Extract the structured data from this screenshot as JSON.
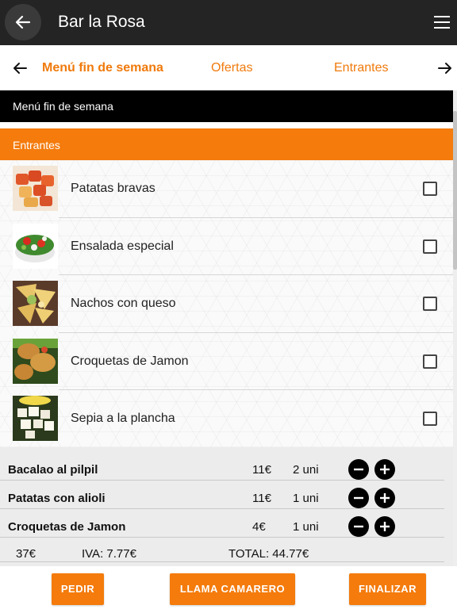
{
  "app": {
    "title": "Bar la Rosa"
  },
  "tabs": {
    "items": [
      {
        "label": "Menú fin de semana",
        "active": true
      },
      {
        "label": "Ofertas",
        "active": false
      },
      {
        "label": "Entrantes",
        "active": false
      }
    ]
  },
  "menu": {
    "section_title": "Menú fin de semana",
    "category": "Entrantes"
  },
  "dishes": [
    {
      "name": "Patatas bravas",
      "checked": false
    },
    {
      "name": "Ensalada especial",
      "checked": false
    },
    {
      "name": "Nachos con queso",
      "checked": false
    },
    {
      "name": "Croquetas de Jamon",
      "checked": false
    },
    {
      "name": "Sepia a la plancha",
      "checked": false
    }
  ],
  "order": {
    "items": [
      {
        "name": "Bacalao al pilpil",
        "price": "11€",
        "qty": "2 uni"
      },
      {
        "name": "Patatas con alioli",
        "price": "11€",
        "qty": "1 uni"
      },
      {
        "name": "Croquetas de Jamon",
        "price": "4€",
        "qty": "1 uni"
      }
    ],
    "subtotal": "37€",
    "iva": "IVA: 7.77€",
    "total": "TOTAL: 44.77€"
  },
  "footer": {
    "pedir": "PEDIR",
    "llama": "LLAMA CAMARERO",
    "finalizar": "FINALIZAR"
  },
  "colors": {
    "accent": "#f47b0c",
    "appbar": "#242424",
    "section": "#000000"
  },
  "icons": {
    "back": "arrow-left-icon",
    "menu": "hamburger-icon",
    "tabs_prev": "arrow-left-icon",
    "tabs_next": "arrow-right-icon",
    "qty_minus": "minus-circle-icon",
    "qty_plus": "plus-circle-icon"
  }
}
